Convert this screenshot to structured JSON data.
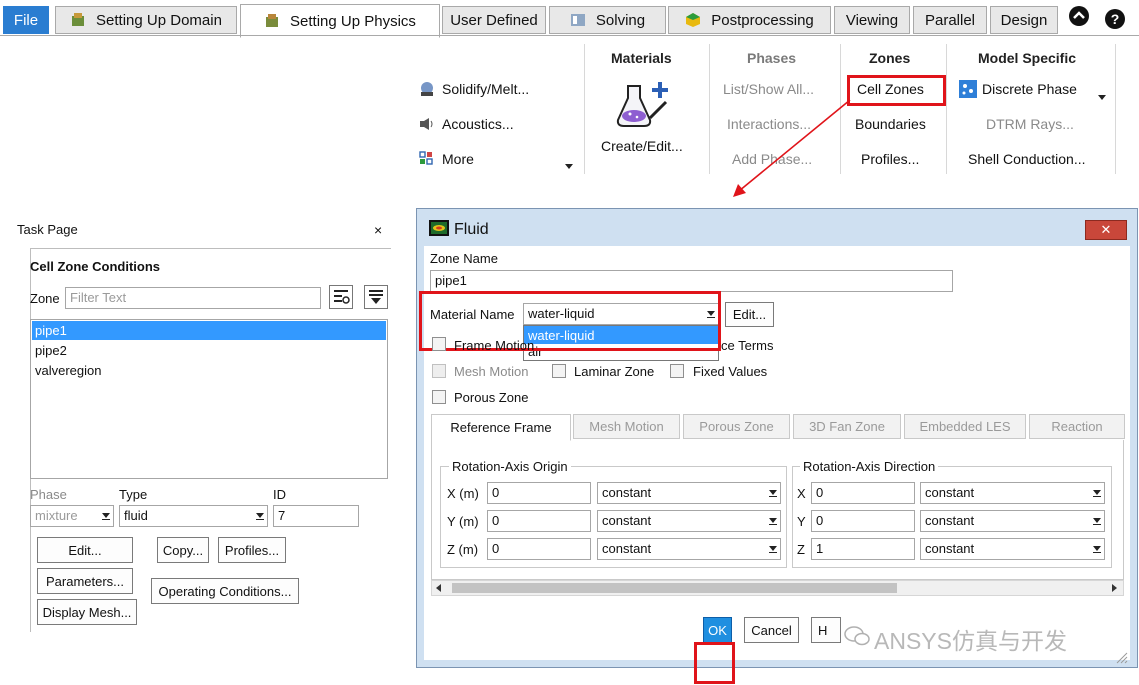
{
  "ribbon": {
    "tabs": [
      {
        "label": "File"
      },
      {
        "label": "Setting Up Domain"
      },
      {
        "label": "Setting Up Physics"
      },
      {
        "label": "User Defined"
      },
      {
        "label": "Solving"
      },
      {
        "label": "Postprocessing"
      },
      {
        "label": "Viewing"
      },
      {
        "label": "Parallel"
      },
      {
        "label": "Design"
      }
    ],
    "left_items": [
      "Solidify/Melt...",
      "Acoustics...",
      "More"
    ],
    "materials": {
      "head": "Materials",
      "create_edit": "Create/Edit..."
    },
    "phases": {
      "head": "Phases",
      "items": [
        "List/Show All...",
        "Interactions...",
        "Add Phase..."
      ]
    },
    "zones": {
      "head": "Zones",
      "items": [
        "Cell Zones",
        "Boundaries",
        "Profiles..."
      ]
    },
    "model_specific": {
      "head": "Model Specific",
      "items": [
        "Discrete Phase",
        "DTRM Rays...",
        "Shell Conduction..."
      ]
    }
  },
  "task_page": {
    "title": "Task Page",
    "close": "×",
    "section_title": "Cell Zone Conditions",
    "zone_label": "Zone",
    "filter_placeholder": "Filter Text",
    "zones": [
      "pipe1",
      "pipe2",
      "valveregion"
    ],
    "phase_label": "Phase",
    "phase_value": "mixture",
    "type_label": "Type",
    "type_value": "fluid",
    "id_label": "ID",
    "id_value": "7",
    "buttons": {
      "edit": "Edit...",
      "copy": "Copy...",
      "profiles": "Profiles...",
      "parameters": "Parameters...",
      "operating": "Operating Conditions...",
      "display_mesh": "Display Mesh..."
    }
  },
  "dialog": {
    "title": "Fluid",
    "close": "✕",
    "zone_name_label": "Zone Name",
    "zone_name_value": "pipe1",
    "material_label": "Material Name",
    "material_value": "water-liquid",
    "material_edit": "Edit...",
    "dropdown_options": [
      "water-liquid",
      "air"
    ],
    "checkboxes": {
      "frame_motion": "Frame Motion",
      "source_terms": "ce Terms",
      "mesh_motion": "Mesh Motion",
      "laminar_zone": "Laminar Zone",
      "fixed_values": "Fixed Values",
      "porous_zone": "Porous Zone"
    },
    "tabs": [
      "Reference Frame",
      "Mesh Motion",
      "Porous Zone",
      "3D Fan Zone",
      "Embedded LES",
      "Reaction"
    ],
    "origin": {
      "title": "Rotation-Axis Origin",
      "rows": [
        {
          "label": "X (m)",
          "value": "0",
          "method": "constant"
        },
        {
          "label": "Y (m)",
          "value": "0",
          "method": "constant"
        },
        {
          "label": "Z (m)",
          "value": "0",
          "method": "constant"
        }
      ]
    },
    "direction": {
      "title": "Rotation-Axis Direction",
      "rows": [
        {
          "label": "X",
          "value": "0",
          "method": "constant"
        },
        {
          "label": "Y",
          "value": "0",
          "method": "constant"
        },
        {
          "label": "Z",
          "value": "1",
          "method": "constant"
        }
      ]
    },
    "buttons": {
      "ok": "OK",
      "cancel": "Cancel",
      "help": "H"
    }
  },
  "watermark": "ANSYS仿真与开发",
  "colors": {
    "accent": "#2a7dd1",
    "highlight": "#e0141a",
    "selection": "#3399ff"
  }
}
